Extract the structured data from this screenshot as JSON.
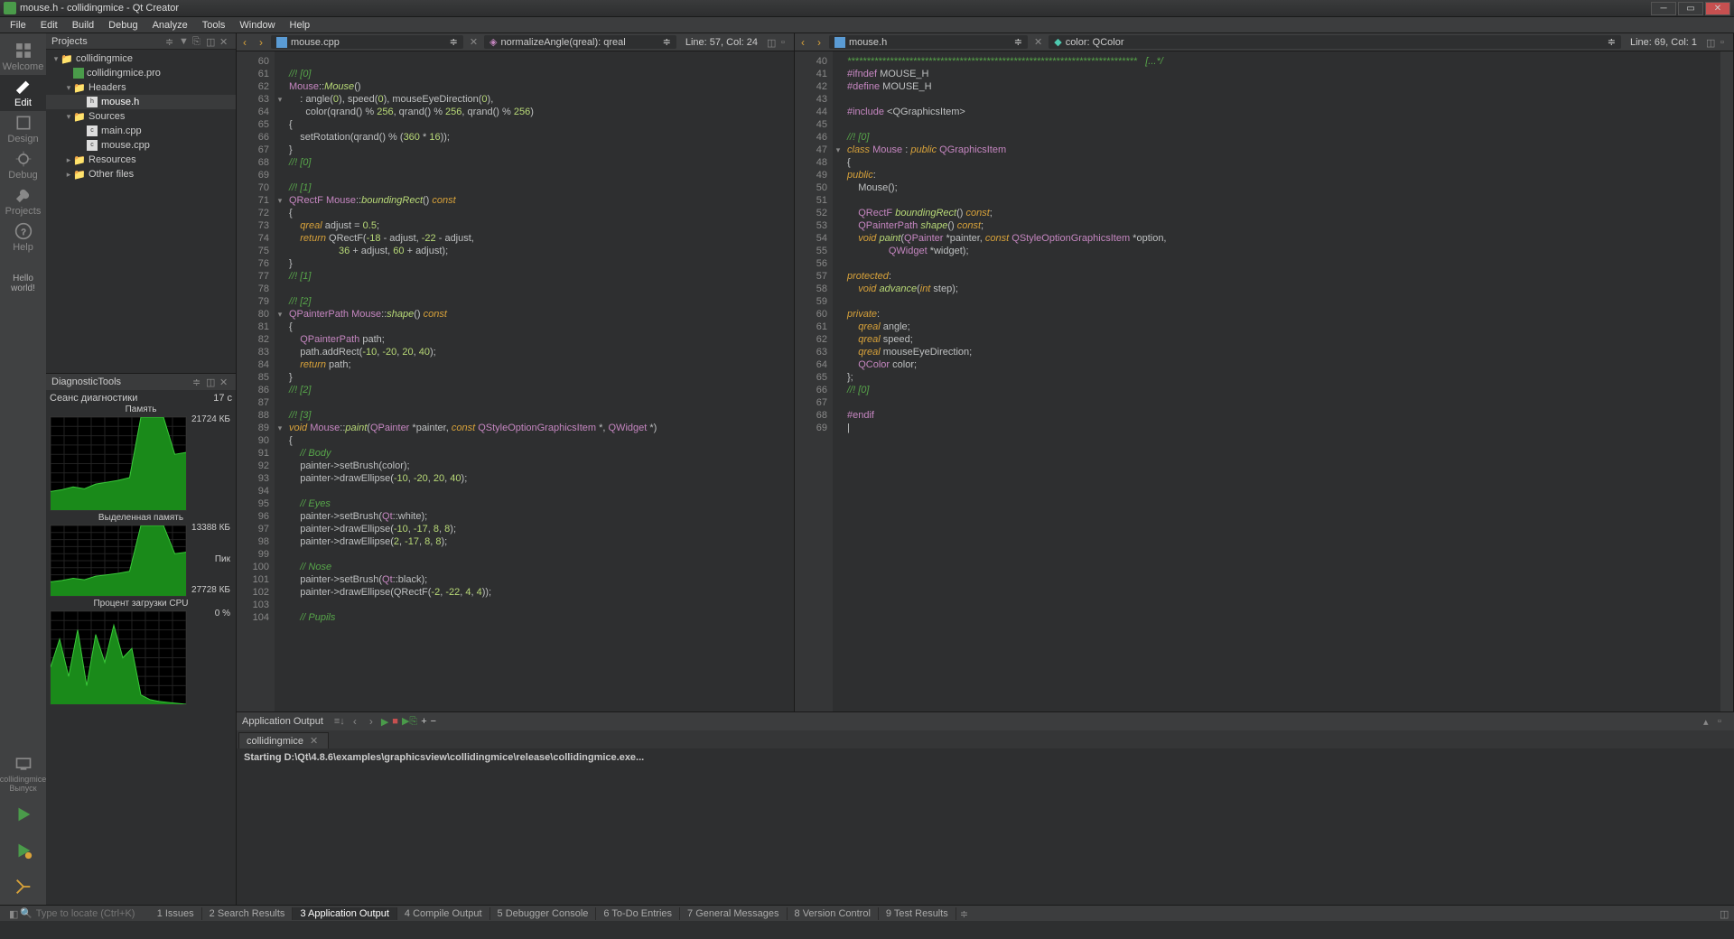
{
  "title": "mouse.h - collidingmice - Qt Creator",
  "menu": [
    "File",
    "Edit",
    "Build",
    "Debug",
    "Analyze",
    "Tools",
    "Window",
    "Help"
  ],
  "rail": [
    {
      "label": "Welcome",
      "icon": "grid"
    },
    {
      "label": "Edit",
      "icon": "edit",
      "active": true
    },
    {
      "label": "Design",
      "icon": "design"
    },
    {
      "label": "Debug",
      "icon": "debug"
    },
    {
      "label": "Projects",
      "icon": "wrench"
    },
    {
      "label": "Help",
      "icon": "help"
    }
  ],
  "hello": "Hello world!",
  "kit": {
    "name": "collidingmice",
    "config": "Выпуск"
  },
  "projects_hdr": "Projects",
  "tree": [
    {
      "depth": 0,
      "arrow": "▾",
      "icon": "folder",
      "label": "collidingmice"
    },
    {
      "depth": 1,
      "arrow": "",
      "icon": "pro",
      "label": "collidingmice.pro"
    },
    {
      "depth": 1,
      "arrow": "▾",
      "icon": "folder",
      "label": "Headers"
    },
    {
      "depth": 2,
      "arrow": "",
      "icon": "h",
      "label": "mouse.h",
      "sel": true
    },
    {
      "depth": 1,
      "arrow": "▾",
      "icon": "folder",
      "label": "Sources"
    },
    {
      "depth": 2,
      "arrow": "",
      "icon": "cpp",
      "label": "main.cpp"
    },
    {
      "depth": 2,
      "arrow": "",
      "icon": "cpp",
      "label": "mouse.cpp"
    },
    {
      "depth": 1,
      "arrow": "▸",
      "icon": "folder",
      "label": "Resources"
    },
    {
      "depth": 1,
      "arrow": "▸",
      "icon": "folder",
      "label": "Other files"
    }
  ],
  "diag_hdr": "DiagnosticTools",
  "diag_session": "Сеанс диагностики",
  "diag_time": "17 с",
  "diag_mem_label": "Память",
  "diag_alloc_label": "Выделенная память",
  "diag_cpu_label": "Процент загрузки CPU",
  "diag_peak_label": "Пик",
  "diag_mem_val": "21724 КБ",
  "diag_alloc_val": "13388 КБ",
  "diag_peak_val": "27728 КБ",
  "diag_cpu_val": "0 %",
  "left_editor": {
    "file": "mouse.cpp",
    "symbol": "normalizeAngle(qreal): qreal",
    "pos": "Line: 57, Col: 24",
    "start_line": 60,
    "lines": [
      {
        "html": ""
      },
      {
        "html": "<span class='cmt'>//! [0]</span>"
      },
      {
        "html": "<span class='cls'>Mouse</span>::<span class='fn'>Mouse</span>()"
      },
      {
        "html": "    : angle(<span class='num'>0</span>), speed(<span class='num'>0</span>), mouseEyeDirection(<span class='num'>0</span>),",
        "fold": "▾"
      },
      {
        "html": "      color(qrand() % <span class='num'>256</span>, qrand() % <span class='num'>256</span>, qrand() % <span class='num'>256</span>)"
      },
      {
        "html": "{"
      },
      {
        "html": "    setRotation(qrand() % (<span class='num'>360</span> * <span class='num'>16</span>));"
      },
      {
        "html": "}"
      },
      {
        "html": "<span class='cmt'>//! [0]</span>"
      },
      {
        "html": ""
      },
      {
        "html": "<span class='cmt'>//! [1]</span>"
      },
      {
        "html": "<span class='cls'>QRectF</span> <span class='cls'>Mouse</span>::<span class='fn'>boundingRect</span>() <span class='kw'>const</span>",
        "fold": "▾"
      },
      {
        "html": "{"
      },
      {
        "html": "    <span class='kw'>qreal</span> adjust = <span class='num'>0.5</span>;"
      },
      {
        "html": "    <span class='kw'>return</span> QRectF(<span class='num'>-18</span> - adjust, <span class='num'>-22</span> - adjust,"
      },
      {
        "html": "                  <span class='num'>36</span> + adjust, <span class='num'>60</span> + adjust);"
      },
      {
        "html": "}"
      },
      {
        "html": "<span class='cmt'>//! [1]</span>"
      },
      {
        "html": ""
      },
      {
        "html": "<span class='cmt'>//! [2]</span>"
      },
      {
        "html": "<span class='cls'>QPainterPath</span> <span class='cls'>Mouse</span>::<span class='fn'>shape</span>() <span class='kw'>const</span>",
        "fold": "▾"
      },
      {
        "html": "{"
      },
      {
        "html": "    <span class='cls'>QPainterPath</span> path;"
      },
      {
        "html": "    path.addRect(<span class='num'>-10</span>, <span class='num'>-20</span>, <span class='num'>20</span>, <span class='num'>40</span>);"
      },
      {
        "html": "    <span class='kw'>return</span> path;"
      },
      {
        "html": "}"
      },
      {
        "html": "<span class='cmt'>//! [2]</span>"
      },
      {
        "html": ""
      },
      {
        "html": "<span class='cmt'>//! [3]</span>"
      },
      {
        "html": "<span class='kw'>void</span> <span class='cls'>Mouse</span>::<span class='fn'>paint</span>(<span class='cls'>QPainter</span> *painter, <span class='kw'>const</span> <span class='cls'>QStyleOptionGraphicsItem</span> *, <span class='cls'>QWidget</span> *)",
        "fold": "▾"
      },
      {
        "html": "{"
      },
      {
        "html": "    <span class='cmt'>// Body</span>"
      },
      {
        "html": "    painter-&gt;setBrush(color);"
      },
      {
        "html": "    painter-&gt;drawEllipse(<span class='num'>-10</span>, <span class='num'>-20</span>, <span class='num'>20</span>, <span class='num'>40</span>);"
      },
      {
        "html": ""
      },
      {
        "html": "    <span class='cmt'>// Eyes</span>"
      },
      {
        "html": "    painter-&gt;setBrush(<span class='cls'>Qt</span>::white);"
      },
      {
        "html": "    painter-&gt;drawEllipse(<span class='num'>-10</span>, <span class='num'>-17</span>, <span class='num'>8</span>, <span class='num'>8</span>);"
      },
      {
        "html": "    painter-&gt;drawEllipse(<span class='num'>2</span>, <span class='num'>-17</span>, <span class='num'>8</span>, <span class='num'>8</span>);"
      },
      {
        "html": ""
      },
      {
        "html": "    <span class='cmt'>// Nose</span>"
      },
      {
        "html": "    painter-&gt;setBrush(<span class='cls'>Qt</span>::black);"
      },
      {
        "html": "    painter-&gt;drawEllipse(QRectF(<span class='num'>-2</span>, <span class='num'>-22</span>, <span class='num'>4</span>, <span class='num'>4</span>));"
      },
      {
        "html": ""
      },
      {
        "html": "    <span class='cmt'>// Pupils</span>"
      }
    ]
  },
  "right_editor": {
    "file": "mouse.h",
    "symbol": "color: QColor",
    "pos": "Line: 69, Col: 1",
    "start_line": 40,
    "lines": [
      {
        "html": "<span class='cmt'>***************************************************************************   [...*/</span>"
      },
      {
        "html": "<span class='pp'>#ifndef</span> MOUSE_H"
      },
      {
        "html": "<span class='pp'>#define</span> MOUSE_H"
      },
      {
        "html": ""
      },
      {
        "html": "<span class='pp'>#include</span> &lt;QGraphicsItem&gt;"
      },
      {
        "html": ""
      },
      {
        "html": "<span class='cmt'>//! [0]</span>"
      },
      {
        "html": "<span class='kw'>class</span> <span class='cls'>Mouse</span> : <span class='kw'>public</span> <span class='cls'>QGraphicsItem</span>",
        "fold": "▾"
      },
      {
        "html": "{"
      },
      {
        "html": "<span class='kw'>public</span>:"
      },
      {
        "html": "    Mouse();"
      },
      {
        "html": ""
      },
      {
        "html": "    <span class='cls'>QRectF</span> <span class='fn'>boundingRect</span>() <span class='kw'>const</span>;"
      },
      {
        "html": "    <span class='cls'>QPainterPath</span> <span class='fn'>shape</span>() <span class='kw'>const</span>;"
      },
      {
        "html": "    <span class='kw'>void</span> <span class='fn'>paint</span>(<span class='cls'>QPainter</span> *painter, <span class='kw'>const</span> <span class='cls'>QStyleOptionGraphicsItem</span> *option,"
      },
      {
        "html": "               <span class='cls'>QWidget</span> *widget);"
      },
      {
        "html": ""
      },
      {
        "html": "<span class='kw'>protected</span>:"
      },
      {
        "html": "    <span class='kw'>void</span> <span class='fn'>advance</span>(<span class='kw'>int</span> step);"
      },
      {
        "html": ""
      },
      {
        "html": "<span class='kw'>private</span>:"
      },
      {
        "html": "    <span class='kw'>qreal</span> angle;"
      },
      {
        "html": "    <span class='kw'>qreal</span> speed;"
      },
      {
        "html": "    <span class='kw'>qreal</span> mouseEyeDirection;"
      },
      {
        "html": "    <span class='cls'>QColor</span> color;"
      },
      {
        "html": "};"
      },
      {
        "html": "<span class='cmt'>//! [0]</span>"
      },
      {
        "html": ""
      },
      {
        "html": "<span class='pp'>#endif</span>"
      },
      {
        "html": "|"
      }
    ]
  },
  "output": {
    "title": "Application Output",
    "tab": "collidingmice",
    "text": "Starting D:\\Qt\\4.8.6\\examples\\graphicsview\\collidingmice\\release\\collidingmice.exe..."
  },
  "status_tabs": [
    "1  Issues",
    "2  Search Results",
    "3  Application Output",
    "4  Compile Output",
    "5  Debugger Console",
    "6  To-Do Entries",
    "7  General Messages",
    "8  Version Control",
    "9  Test Results"
  ],
  "status_active": 2,
  "locator_placeholder": "Type to locate (Ctrl+K)",
  "chart_data": [
    {
      "type": "area",
      "title": "Память",
      "values": [
        20,
        22,
        25,
        23,
        28,
        30,
        32,
        35,
        100,
        100,
        100,
        60,
        62
      ],
      "ylim": [
        0,
        100
      ]
    },
    {
      "type": "area",
      "title": "Выделенная память",
      "values": [
        20,
        22,
        25,
        23,
        28,
        30,
        32,
        35,
        100,
        100,
        100,
        60,
        62
      ],
      "ylim": [
        0,
        100
      ]
    },
    {
      "type": "area",
      "title": "Процент загрузки CPU",
      "values": [
        40,
        70,
        30,
        80,
        20,
        75,
        45,
        85,
        50,
        60,
        10,
        5,
        3,
        2,
        1,
        0
      ],
      "ylim": [
        0,
        100
      ]
    }
  ]
}
